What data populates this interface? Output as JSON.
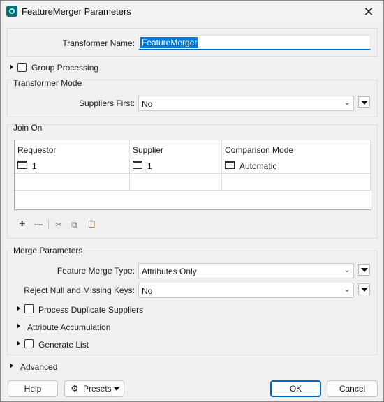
{
  "window": {
    "title": "FeatureMerger Parameters",
    "close_symbol": "✕"
  },
  "transformer": {
    "name_label": "Transformer Name:",
    "name_value": "FeatureMerger"
  },
  "group_processing": {
    "label": "Group Processing",
    "checked": false
  },
  "transformer_mode": {
    "title": "Transformer Mode",
    "suppliers_first_label": "Suppliers First:",
    "suppliers_first_value": "No"
  },
  "join_on": {
    "title": "Join On",
    "columns": [
      "Requestor",
      "Supplier",
      "Comparison Mode"
    ],
    "rows": [
      {
        "requestor": "1",
        "supplier": "1",
        "comparison_mode": "Automatic"
      }
    ],
    "toolbar": {
      "add": "+",
      "remove": "—",
      "cut": "✂",
      "copy": "⧉",
      "paste": "📋"
    }
  },
  "merge_parameters": {
    "title": "Merge Parameters",
    "feature_merge_type_label": "Feature Merge Type:",
    "feature_merge_type_value": "Attributes Only",
    "reject_null_label": "Reject Null and Missing Keys:",
    "reject_null_value": "No",
    "process_duplicate_label": "Process Duplicate Suppliers",
    "attribute_accumulation_label": "Attribute Accumulation",
    "generate_list_label": "Generate List"
  },
  "advanced": {
    "label": "Advanced"
  },
  "footer": {
    "help_label": "Help",
    "presets_label": "Presets",
    "ok_label": "OK",
    "cancel_label": "Cancel"
  },
  "colors": {
    "accent": "#0067c0",
    "selection": "#0078d7",
    "icon_teal": "#0b6e74"
  }
}
